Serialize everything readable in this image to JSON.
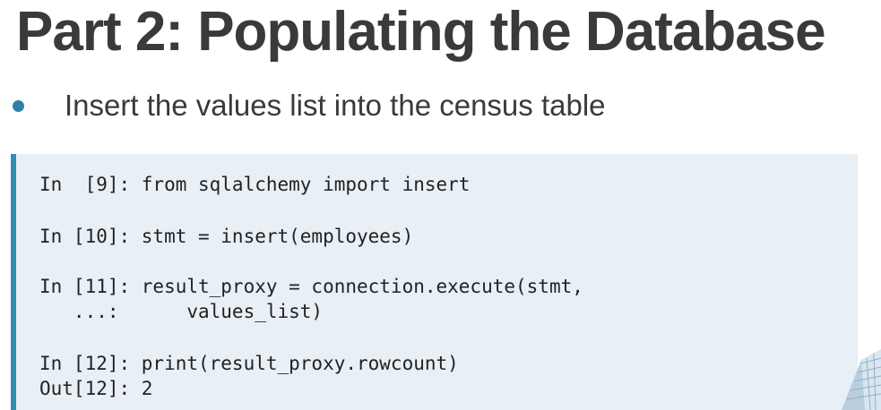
{
  "slide": {
    "title": "Part 2: Populating the Database",
    "bullet": "Insert the values list into the census table"
  },
  "code": {
    "lines": [
      "In  [9]: from sqlalchemy import insert",
      "In [10]: stmt = insert(employees)",
      "In [11]: result_proxy = connection.execute(stmt,",
      "   ...:      values_list)",
      "In [12]: print(result_proxy.rowcount)",
      "Out[12]: 2"
    ]
  },
  "colors": {
    "accent": "#2f8fb0",
    "code_background": "#e8eff5",
    "text": "#3a3a3a"
  }
}
